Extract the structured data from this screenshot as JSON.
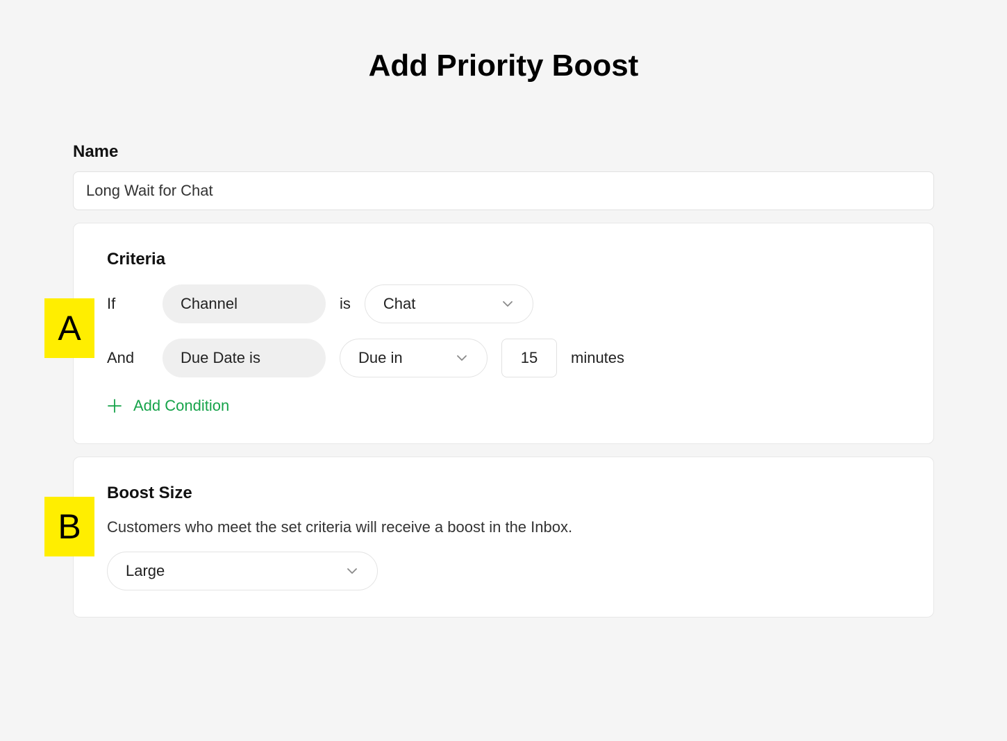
{
  "title": "Add Priority Boost",
  "name": {
    "label": "Name",
    "value": "Long Wait for Chat"
  },
  "criteria": {
    "heading": "Criteria",
    "rows": [
      {
        "prefix": "If",
        "attribute": "Channel",
        "operator": "is",
        "value": "Chat"
      },
      {
        "prefix": "And",
        "attribute": "Due Date is",
        "comparator": "Due in",
        "number": "15",
        "unit": "minutes"
      }
    ],
    "add_condition": "Add Condition"
  },
  "boost": {
    "heading": "Boost Size",
    "description": "Customers who meet the set criteria will receive a boost in the Inbox.",
    "value": "Large"
  },
  "markers": {
    "a": "A",
    "b": "B"
  }
}
